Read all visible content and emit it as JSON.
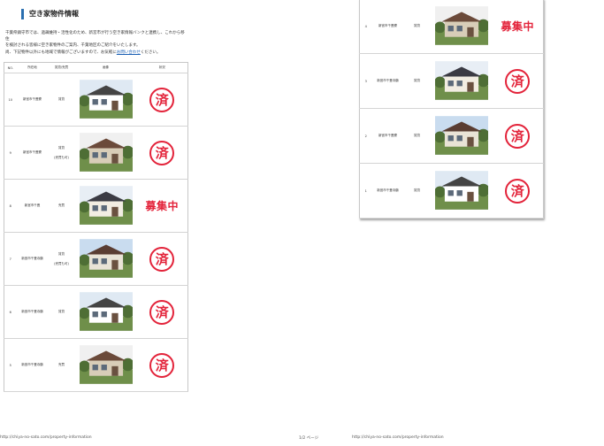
{
  "page": {
    "title": "空き家物件情報",
    "intro": [
      "千葉県鎮守市では、過疎維持・活性化のため、新宮市が行う空き家情報バンクと連携し、これから移住",
      "を検討される皆様に空き家物件のご案内、千葉地区のご紹介をいたします。"
    ],
    "notice": "尚、下記物件以外にも地域で情報がございますので、お気軽にお問い合わせください。",
    "notice_link": "お問い合わせ"
  },
  "table": {
    "headers": [
      "NO.",
      "所在地",
      "賃貸/売買",
      "画像",
      "状況"
    ]
  },
  "rows_left": [
    {
      "no": "10",
      "location": "新宮市千畳寮",
      "type": "賃貸",
      "note": "",
      "status": "stamp",
      "photo": "house-10-photo"
    },
    {
      "no": "9",
      "location": "新宮市千畳寮",
      "type": "賃貸",
      "note": "(売買も可)",
      "status": "stamp",
      "photo": "house-9-photo"
    },
    {
      "no": "8",
      "location": "新宮市千畳",
      "type": "売買",
      "note": "",
      "status": "recruiting",
      "photo": "house-8-photo"
    },
    {
      "no": "7",
      "location": "新宮市千畳寺鶴",
      "type": "賃貸",
      "note": "(売買も可)",
      "status": "stamp",
      "photo": "house-7-photo"
    },
    {
      "no": "6",
      "location": "新宮市千畳寺鶴",
      "type": "賃貸",
      "note": "",
      "status": "stamp",
      "photo": "house-6-photo"
    },
    {
      "no": "5",
      "location": "新宮市千畳寺鶴",
      "type": "売買",
      "note": "",
      "status": "stamp",
      "photo": "house-5-photo"
    }
  ],
  "rows_right": [
    {
      "no": "4",
      "location": "新宮市千畳寮",
      "type": "賃貸",
      "note": "",
      "status": "recruiting",
      "photo": "house-4-photo"
    },
    {
      "no": "3",
      "location": "新宮市千畳寺鶴",
      "type": "賃貸",
      "note": "",
      "status": "stamp",
      "photo": "house-3-photo"
    },
    {
      "no": "2",
      "location": "新宮市千畳寮",
      "type": "賃貸",
      "note": "",
      "status": "stamp",
      "photo": "house-2-photo"
    },
    {
      "no": "1",
      "location": "新宮市千畳寺鶴",
      "type": "賃貸",
      "note": "",
      "status": "stamp",
      "photo": "house-1-photo"
    }
  ],
  "status_labels": {
    "stamp": "済",
    "recruiting": "募集中"
  },
  "colors": {
    "accent": "#2a6fb0",
    "stamp": "#e3233a",
    "link": "#1a5fb4"
  },
  "footer": {
    "left_url": "http://chiya-no-sato.com/property-information",
    "page": "1/2 ページ",
    "right_url": "http://chiya-no-sato.com/property-information"
  }
}
